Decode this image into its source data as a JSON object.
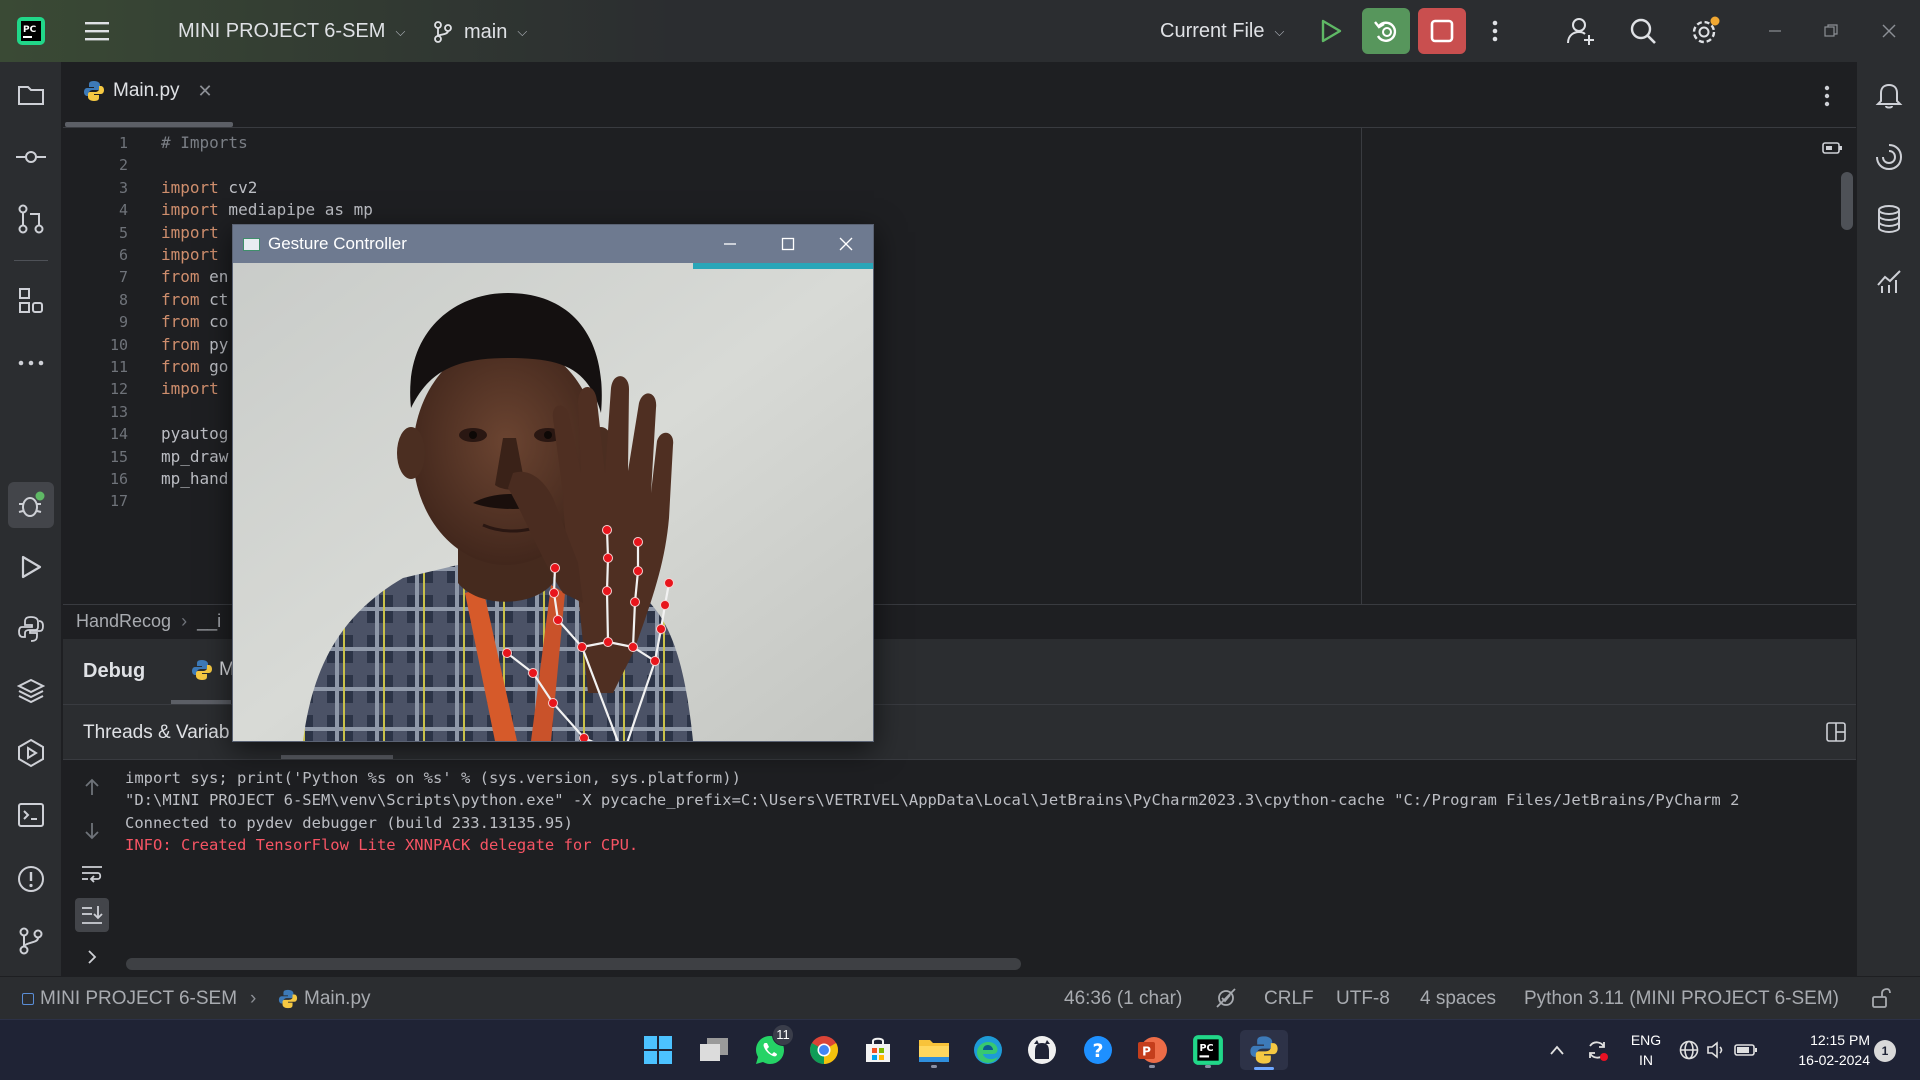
{
  "titlebar": {
    "project": "MINI PROJECT 6-SEM",
    "branch": "main",
    "run_config": "Current File"
  },
  "tabs": [
    {
      "label": "Main.py"
    }
  ],
  "editor": {
    "line_numbers": [
      "1",
      "2",
      "3",
      "4",
      "5",
      "6",
      "7",
      "8",
      "9",
      "10",
      "11",
      "12",
      "13",
      "14",
      "15",
      "16",
      "17"
    ],
    "lines": [
      {
        "kw": "",
        "text": "# Imports",
        "comment": true
      },
      {
        "kw": "",
        "text": ""
      },
      {
        "kw": "import",
        "text": " cv2"
      },
      {
        "kw": "import",
        "text": " mediapipe as mp"
      },
      {
        "kw": "import",
        "text": ""
      },
      {
        "kw": "import",
        "text": ""
      },
      {
        "kw": "from",
        "text": " en"
      },
      {
        "kw": "from",
        "text": " ct"
      },
      {
        "kw": "from",
        "text": " co"
      },
      {
        "kw": "from",
        "text": " py"
      },
      {
        "kw": "from",
        "text": " go"
      },
      {
        "kw": "import",
        "text": ""
      },
      {
        "kw": "",
        "text": ""
      },
      {
        "kw": "",
        "text": "pyautog"
      },
      {
        "kw": "",
        "text": "mp_draw"
      },
      {
        "kw": "",
        "text": "mp_hand"
      },
      {
        "kw": "",
        "text": ""
      }
    ]
  },
  "breadcrumb": {
    "item1": "HandRecog",
    "item2": "__i"
  },
  "debug": {
    "tab_label": "Debug",
    "session_label": "M",
    "threads_label": "Threads & Variab"
  },
  "console": {
    "lines": [
      {
        "text": "import sys; print('Python %s on %s' % (sys.version, sys.platform))",
        "error": false
      },
      {
        "text": "\"D:\\MINI PROJECT 6-SEM\\venv\\Scripts\\python.exe\" -X pycache_prefix=C:\\Users\\VETRIVEL\\AppData\\Local\\JetBrains\\PyCharm2023.3\\cpython-cache \"C:/Program Files/JetBrains/PyCharm 2",
        "error": false
      },
      {
        "text": "Connected to pydev debugger (build 233.13135.95)",
        "error": false
      },
      {
        "text": "INFO: Created TensorFlow Lite XNNPACK delegate for CPU.",
        "error": true
      }
    ]
  },
  "gesture_window": {
    "title": "Gesture Controller"
  },
  "statusbar": {
    "project": "MINI PROJECT 6-SEM",
    "file": "Main.py",
    "position": "46:36 (1 char)",
    "line_ending": "CRLF",
    "encoding": "UTF-8",
    "indent": "4 spaces",
    "interpreter": "Python 3.11 (MINI PROJECT 6-SEM)"
  },
  "taskbar": {
    "whatsapp_badge": "11",
    "lang_top": "ENG",
    "lang_bottom": "IN",
    "time": "12:15 PM",
    "date": "16-02-2024",
    "notif_count": "1"
  },
  "colors": {
    "accent_green": "#57965c",
    "stop_red": "#c94f4f",
    "keyword": "#cf8e6d",
    "error_text": "#f75464"
  }
}
